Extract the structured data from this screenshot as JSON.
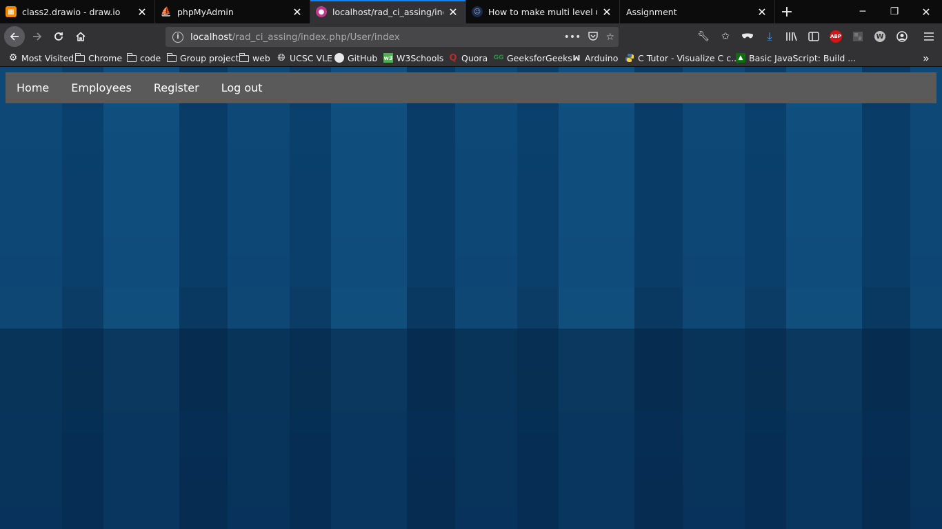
{
  "tabs": [
    {
      "label": "class2.drawio - draw.io",
      "icon": "drawio-icon",
      "color": "#f08705"
    },
    {
      "label": "phpMyAdmin",
      "icon": "phpmyadmin-icon",
      "color": "#f89c0e"
    },
    {
      "label": "localhost/rad_ci_assing/index.p",
      "icon": "site-icon",
      "color": "#c2388f"
    },
    {
      "label": "How to make multi level user lo",
      "icon": "profile-icon",
      "color": "#1a2a4a"
    },
    {
      "label": "Assignment",
      "icon": "",
      "color": ""
    }
  ],
  "address": {
    "host": "localhost",
    "path": "/rad_ci_assing/index.php/User/index"
  },
  "bookmarks": [
    {
      "label": "Most Visited",
      "icon": "gear-icon"
    },
    {
      "label": "Chrome",
      "icon": "folder-icon"
    },
    {
      "label": "code",
      "icon": "folder-icon"
    },
    {
      "label": "Group project",
      "icon": "folder-icon"
    },
    {
      "label": "web",
      "icon": "folder-icon"
    },
    {
      "label": "UCSC VLE",
      "icon": "globe-icon"
    },
    {
      "label": "GitHub",
      "icon": "github-icon"
    },
    {
      "label": "W3Schools",
      "icon": "w3schools-icon"
    },
    {
      "label": "Quora",
      "icon": "quora-icon"
    },
    {
      "label": "GeeksforGeeks",
      "icon": "geeksforgeeks-icon"
    },
    {
      "label": "Arduino",
      "icon": "arduino-icon"
    },
    {
      "label": "C Tutor - Visualize C c...",
      "icon": "python-icon"
    },
    {
      "label": "Basic JavaScript: Build ...",
      "icon": "freecodecamp-icon"
    }
  ],
  "toolbar": {
    "abp_label": "ABP",
    "extension_letter": "W"
  },
  "site_nav": {
    "home": "Home",
    "employees": "Employees",
    "register": "Register",
    "logout": "Log out"
  }
}
